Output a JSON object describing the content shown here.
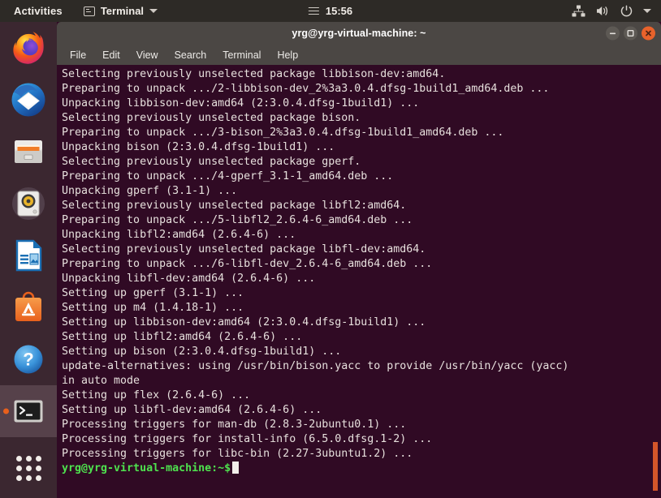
{
  "topbar": {
    "activities_label": "Activities",
    "app_indicator": {
      "icon": "terminal-icon",
      "label": "Terminal"
    },
    "clock": {
      "menu_icon": "hamburger-icon",
      "time": "15:56"
    },
    "status_icons": [
      "network-workgroup-icon",
      "volume-speaker-icon",
      "power-icon",
      "chevron-down-icon"
    ],
    "background": "#2d2a26"
  },
  "dock": {
    "background": "#3b2730",
    "items": [
      {
        "name": "firefox",
        "label": "Firefox",
        "icon": "firefox-icon",
        "active": false
      },
      {
        "name": "thunderbird",
        "label": "Thunderbird Mail",
        "icon": "thunderbird-icon",
        "active": false
      },
      {
        "name": "files",
        "label": "Files",
        "icon": "file-manager-icon",
        "active": false
      },
      {
        "name": "rhythmbox",
        "label": "Rhythmbox",
        "icon": "music-player-icon",
        "active": false
      },
      {
        "name": "libreoffice",
        "label": "LibreOffice Writer",
        "icon": "document-writer-icon",
        "active": false
      },
      {
        "name": "ubuntu-software",
        "label": "Ubuntu Software",
        "icon": "software-bag-icon",
        "active": false
      },
      {
        "name": "help",
        "label": "Help",
        "icon": "help-question-icon",
        "active": false
      },
      {
        "name": "terminal",
        "label": "Terminal",
        "icon": "terminal-icon",
        "active": true
      }
    ],
    "app_grid": {
      "label": "Show Applications",
      "icon": "app-grid-icon"
    }
  },
  "window": {
    "title": "yrg@yrg-virtual-machine: ~",
    "controls": {
      "minimize": "minimize-icon",
      "maximize": "maximize-icon",
      "close": "close-icon",
      "close_color": "#e8622b"
    },
    "menu": [
      "File",
      "Edit",
      "View",
      "Search",
      "Terminal",
      "Help"
    ],
    "titlebar_background": "#4b4744"
  },
  "terminal": {
    "background": "#300a24",
    "foreground": "#e7e0dd",
    "prompt_color": "#4ee24e",
    "scrollbar_color": "#d4562a",
    "lines": [
      "Selecting previously unselected package libbison-dev:amd64.",
      "Preparing to unpack .../2-libbison-dev_2%3a3.0.4.dfsg-1build1_amd64.deb ...",
      "Unpacking libbison-dev:amd64 (2:3.0.4.dfsg-1build1) ...",
      "Selecting previously unselected package bison.",
      "Preparing to unpack .../3-bison_2%3a3.0.4.dfsg-1build1_amd64.deb ...",
      "Unpacking bison (2:3.0.4.dfsg-1build1) ...",
      "Selecting previously unselected package gperf.",
      "Preparing to unpack .../4-gperf_3.1-1_amd64.deb ...",
      "Unpacking gperf (3.1-1) ...",
      "Selecting previously unselected package libfl2:amd64.",
      "Preparing to unpack .../5-libfl2_2.6.4-6_amd64.deb ...",
      "Unpacking libfl2:amd64 (2.6.4-6) ...",
      "Selecting previously unselected package libfl-dev:amd64.",
      "Preparing to unpack .../6-libfl-dev_2.6.4-6_amd64.deb ...",
      "Unpacking libfl-dev:amd64 (2.6.4-6) ...",
      "Setting up gperf (3.1-1) ...",
      "Setting up m4 (1.4.18-1) ...",
      "Setting up libbison-dev:amd64 (2:3.0.4.dfsg-1build1) ...",
      "Setting up libfl2:amd64 (2.6.4-6) ...",
      "Setting up bison (2:3.0.4.dfsg-1build1) ...",
      "update-alternatives: using /usr/bin/bison.yacc to provide /usr/bin/yacc (yacc)",
      "in auto mode",
      "Setting up flex (2.6.4-6) ...",
      "Setting up libfl-dev:amd64 (2.6.4-6) ...",
      "Processing triggers for man-db (2.8.3-2ubuntu0.1) ...",
      "Processing triggers for install-info (6.5.0.dfsg.1-2) ...",
      "Processing triggers for libc-bin (2.27-3ubuntu1.2) ..."
    ],
    "prompt": "yrg@yrg-virtual-machine:~$",
    "prompt_input": ""
  }
}
